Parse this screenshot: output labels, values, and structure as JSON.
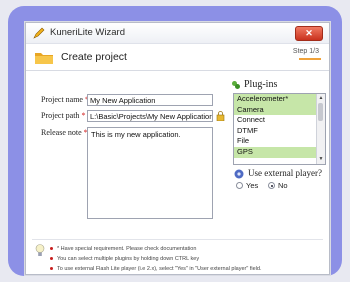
{
  "window": {
    "title": "KuneriLite Wizard",
    "close_label": "✕"
  },
  "header": {
    "heading": "Create project",
    "step": "Step 1/3"
  },
  "form": {
    "project_name_label": "Project name",
    "project_name_value": "My New Application",
    "project_path_label": "Project path",
    "project_path_value": "L:\\Basic\\Projects\\My New Application\\",
    "release_note_label": "Release note",
    "release_note_value": "This is my new application.",
    "required_marker": "*"
  },
  "plugins": {
    "title": "Plug-ins",
    "items": [
      {
        "label": "Accelerometer*",
        "selected": true
      },
      {
        "label": "Camera",
        "selected": true
      },
      {
        "label": "Connect",
        "selected": false
      },
      {
        "label": "DTMF",
        "selected": false
      },
      {
        "label": "File",
        "selected": false
      },
      {
        "label": "GPS",
        "selected": true
      }
    ]
  },
  "external_player": {
    "question": "Use external player?",
    "yes_label": "Yes",
    "no_label": "No",
    "selected": "No"
  },
  "notes": [
    "* Have special requirement. Please check documentation",
    "You can select multiple plugins by holding down CTRL key",
    "To use external Flash Lite player (i.e 2.x), select \"Yes\" in \"User external player\" field."
  ],
  "colors": {
    "accent": "#f0a23a",
    "selection": "#c6e6a8",
    "frame": "#8c90e6",
    "required": "#d0191a"
  }
}
